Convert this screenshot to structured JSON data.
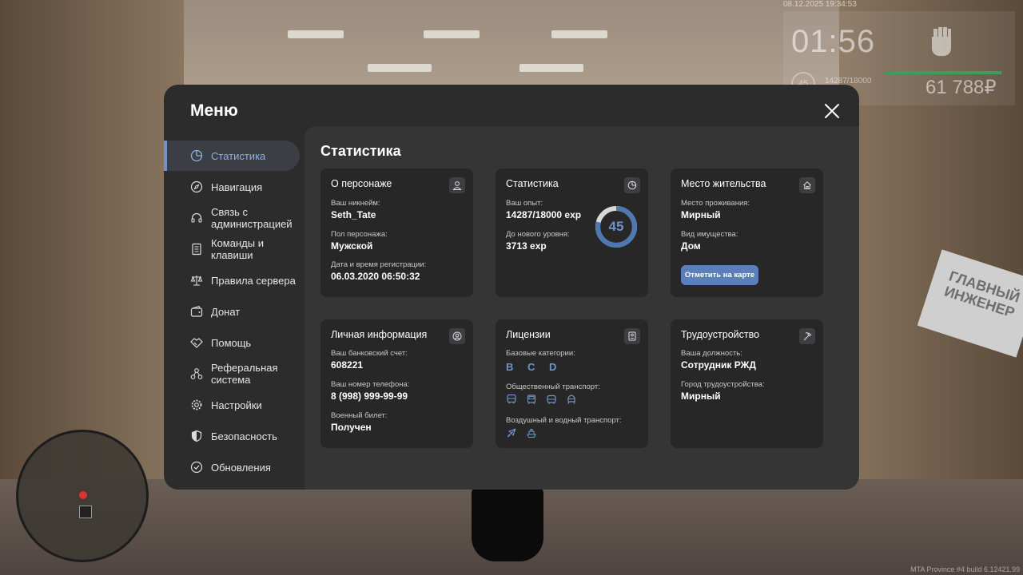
{
  "hud": {
    "datetime": "08.12.2025 19:34:53",
    "time": "01:56",
    "level": "45",
    "exp": "14287/18000",
    "money": "61 788₽"
  },
  "sign": "ГЛАВНЫЙ ИНЖЕНЕР",
  "version": "MTA Province #4 build 6.12421.99",
  "menu": {
    "title": "Меню",
    "nav": [
      {
        "label": "Статистика",
        "icon": "pie-chart-icon",
        "active": true
      },
      {
        "label": "Навигация",
        "icon": "compass-icon"
      },
      {
        "label": "Связь с администрацией",
        "icon": "headset-icon"
      },
      {
        "label": "Команды и клавиши",
        "icon": "document-icon"
      },
      {
        "label": "Правила сервера",
        "icon": "scales-icon"
      },
      {
        "label": "Донат",
        "icon": "wallet-icon"
      },
      {
        "label": "Помощь",
        "icon": "handshake-icon"
      },
      {
        "label": "Реферальная система",
        "icon": "network-icon"
      },
      {
        "label": "Настройки",
        "icon": "gear-icon"
      },
      {
        "label": "Безопасность",
        "icon": "shield-icon"
      },
      {
        "label": "Обновления",
        "icon": "check-circle-icon"
      }
    ],
    "content_title": "Статистика",
    "character": {
      "title": "О персонаже",
      "nickname_label": "Ваш никнейм:",
      "nickname": "Seth_Tate",
      "gender_label": "Пол персонажа:",
      "gender": "Мужской",
      "reg_label": "Дата и время регистрации:",
      "reg": "06.03.2020 06:50:32"
    },
    "stats": {
      "title": "Статистика",
      "exp_label": "Ваш опыт:",
      "exp": "14287/18000 exp",
      "next_label": "До нового уровня:",
      "next": "3713 exp",
      "level": "45",
      "progress": 0.79
    },
    "residence": {
      "title": "Место жительства",
      "place_label": "Место проживания:",
      "place": "Мирный",
      "property_label": "Вид имущества:",
      "property": "Дом",
      "button": "Отметить на карте"
    },
    "personal": {
      "title": "Личная информация",
      "bank_label": "Ваш банковский счет:",
      "bank": "608221",
      "phone_label": "Ваш номер телефона:",
      "phone": "8 (998) 999-99-99",
      "military_label": "Военный билет:",
      "military": "Получен"
    },
    "licenses": {
      "title": "Лицензии",
      "base_label": "Базовые категории:",
      "base": "B C D",
      "public_label": "Общественный транспорт:",
      "air_label": "Воздушный и водный транспорт:"
    },
    "job": {
      "title": "Трудоустройство",
      "position_label": "Ваша должность:",
      "position": "Сотрудник РЖД",
      "city_label": "Город трудоустройства:",
      "city": "Мирный"
    }
  }
}
